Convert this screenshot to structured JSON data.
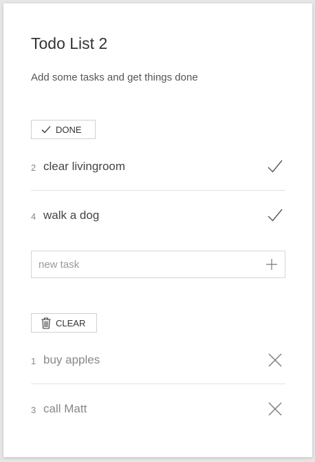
{
  "header": {
    "title": "Todo List 2",
    "subtitle": "Add some tasks and get things done"
  },
  "done_section": {
    "button_label": "DONE",
    "button_icon": "checkmark-icon",
    "items": [
      {
        "number": "2",
        "text": "clear livingroom",
        "action_icon": "checkmark-icon"
      },
      {
        "number": "4",
        "text": "walk a dog",
        "action_icon": "checkmark-icon"
      }
    ]
  },
  "new_task": {
    "placeholder": "new task",
    "value": "",
    "add_icon": "plus-icon"
  },
  "todo_section": {
    "button_label": "CLEAR",
    "button_icon": "trash-icon",
    "items": [
      {
        "number": "1",
        "text": "buy apples",
        "action_icon": "close-icon"
      },
      {
        "number": "3",
        "text": "call Matt",
        "action_icon": "close-icon"
      }
    ]
  },
  "colors": {
    "background": "#e6e6e6",
    "card": "#ffffff",
    "text_primary": "#333333",
    "text_muted": "#888888",
    "border": "#d0d0d0"
  }
}
